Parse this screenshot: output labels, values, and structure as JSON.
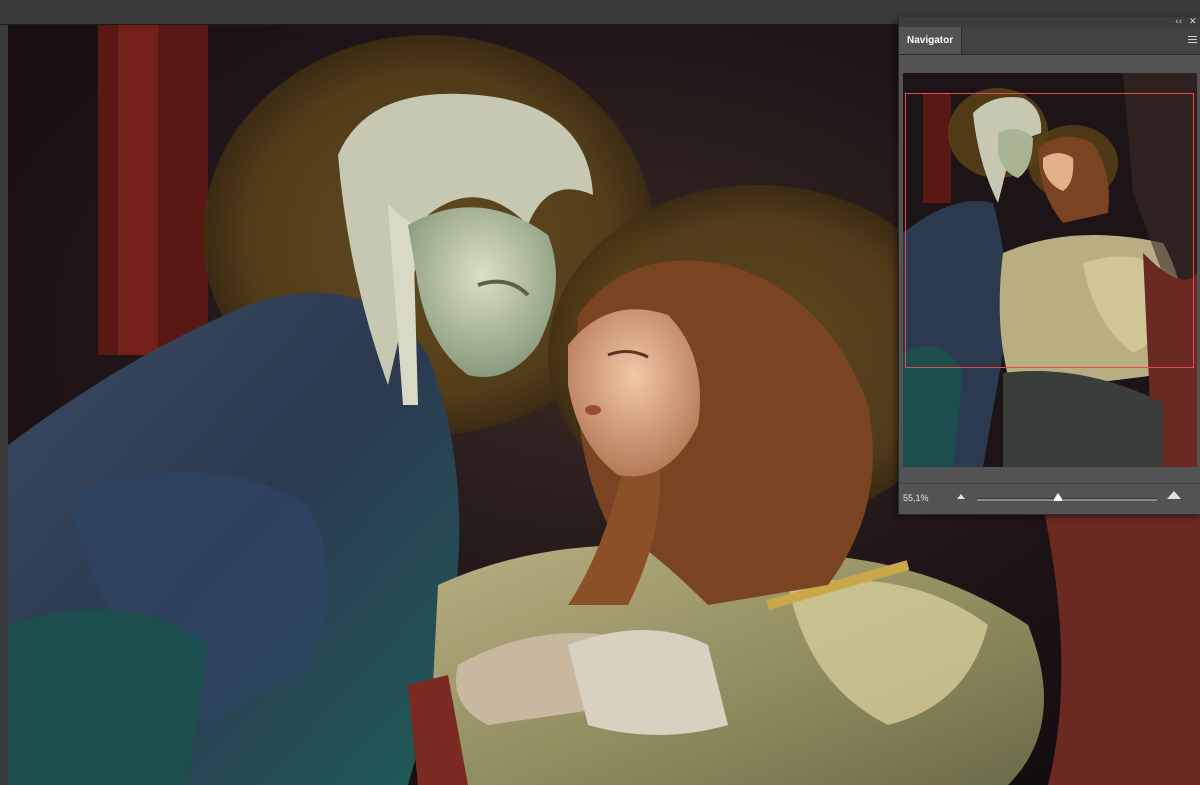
{
  "app": {
    "top_bar": ""
  },
  "navigator": {
    "tab_label": "Navigator",
    "collapse_icon": "double-chevron-left-icon",
    "close_icon": "close-icon",
    "menu_icon": "panel-menu-icon",
    "zoom_value": "55,1%",
    "zoom_slider_fraction": 0.45,
    "view_box_color": "#e84a4a"
  },
  "colors": {
    "panel_bg": "#535353",
    "titlebar_bg": "#3d3d3d",
    "canvas_bg": "#282828"
  }
}
